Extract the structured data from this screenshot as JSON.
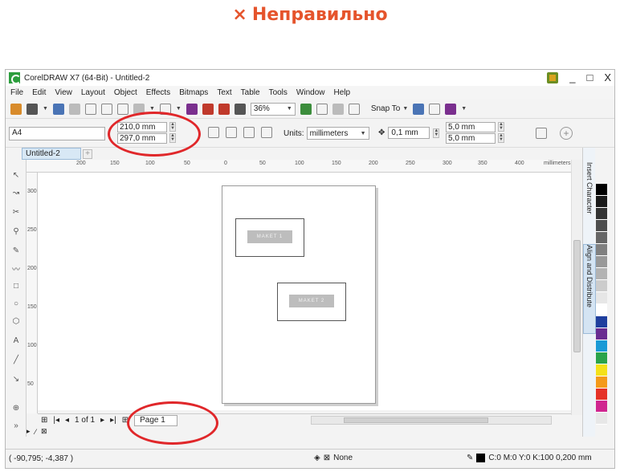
{
  "heading": {
    "mark": "×",
    "text": "Неправильно"
  },
  "window": {
    "title": "CorelDRAW X7 (64-Bit) - Untitled-2"
  },
  "window_controls": {
    "minimize": "_",
    "maximize": "□",
    "close": "X"
  },
  "menu": [
    "File",
    "Edit",
    "View",
    "Layout",
    "Object",
    "Effects",
    "Bitmaps",
    "Text",
    "Table",
    "Tools",
    "Window",
    "Help"
  ],
  "toolbar": {
    "zoom": "36%",
    "snap_to": "Snap To"
  },
  "property_bar": {
    "paper_size": "A4",
    "width": "210,0 mm",
    "height": "297,0 mm",
    "units_label": "Units:",
    "units": "millimeters",
    "nudge": "0,1 mm",
    "dup_x": "5,0 mm",
    "dup_y": "5,0 mm"
  },
  "document_tab": "Untitled-2",
  "ruler": {
    "unit": "millimeters",
    "h_labels": [
      "200",
      "150",
      "100",
      "50",
      "0",
      "50",
      "100",
      "150",
      "200",
      "250",
      "300",
      "350",
      "400"
    ],
    "v_labels": [
      "300",
      "250",
      "200",
      "150",
      "100",
      "50"
    ]
  },
  "canvas": {
    "objects": [
      {
        "label": "MAKET 1"
      },
      {
        "label": "MAKET 2"
      }
    ]
  },
  "page_nav": {
    "counter": "1 of 1",
    "page_tab": "Page 1"
  },
  "dockers": [
    "Insert Character",
    "Align and Distribute"
  ],
  "palette": [
    "#000000",
    "#1a1a1a",
    "#333333",
    "#4d4d4d",
    "#666666",
    "#808080",
    "#999999",
    "#b3b3b3",
    "#cccccc",
    "#e6e6e6",
    "#ffffff",
    "#1f3f9e",
    "#6a2d91",
    "#1a9ad6",
    "#2aa34a",
    "#f4e11a",
    "#f49a1a",
    "#e53227",
    "#d02690",
    "#e7e7e7"
  ],
  "status": {
    "coords": "( -90,795; -4,387 )",
    "fill": "None",
    "outline": "C:0 M:0 Y:0 K:100  0,200 mm"
  },
  "annotation_color": "#e0272a"
}
